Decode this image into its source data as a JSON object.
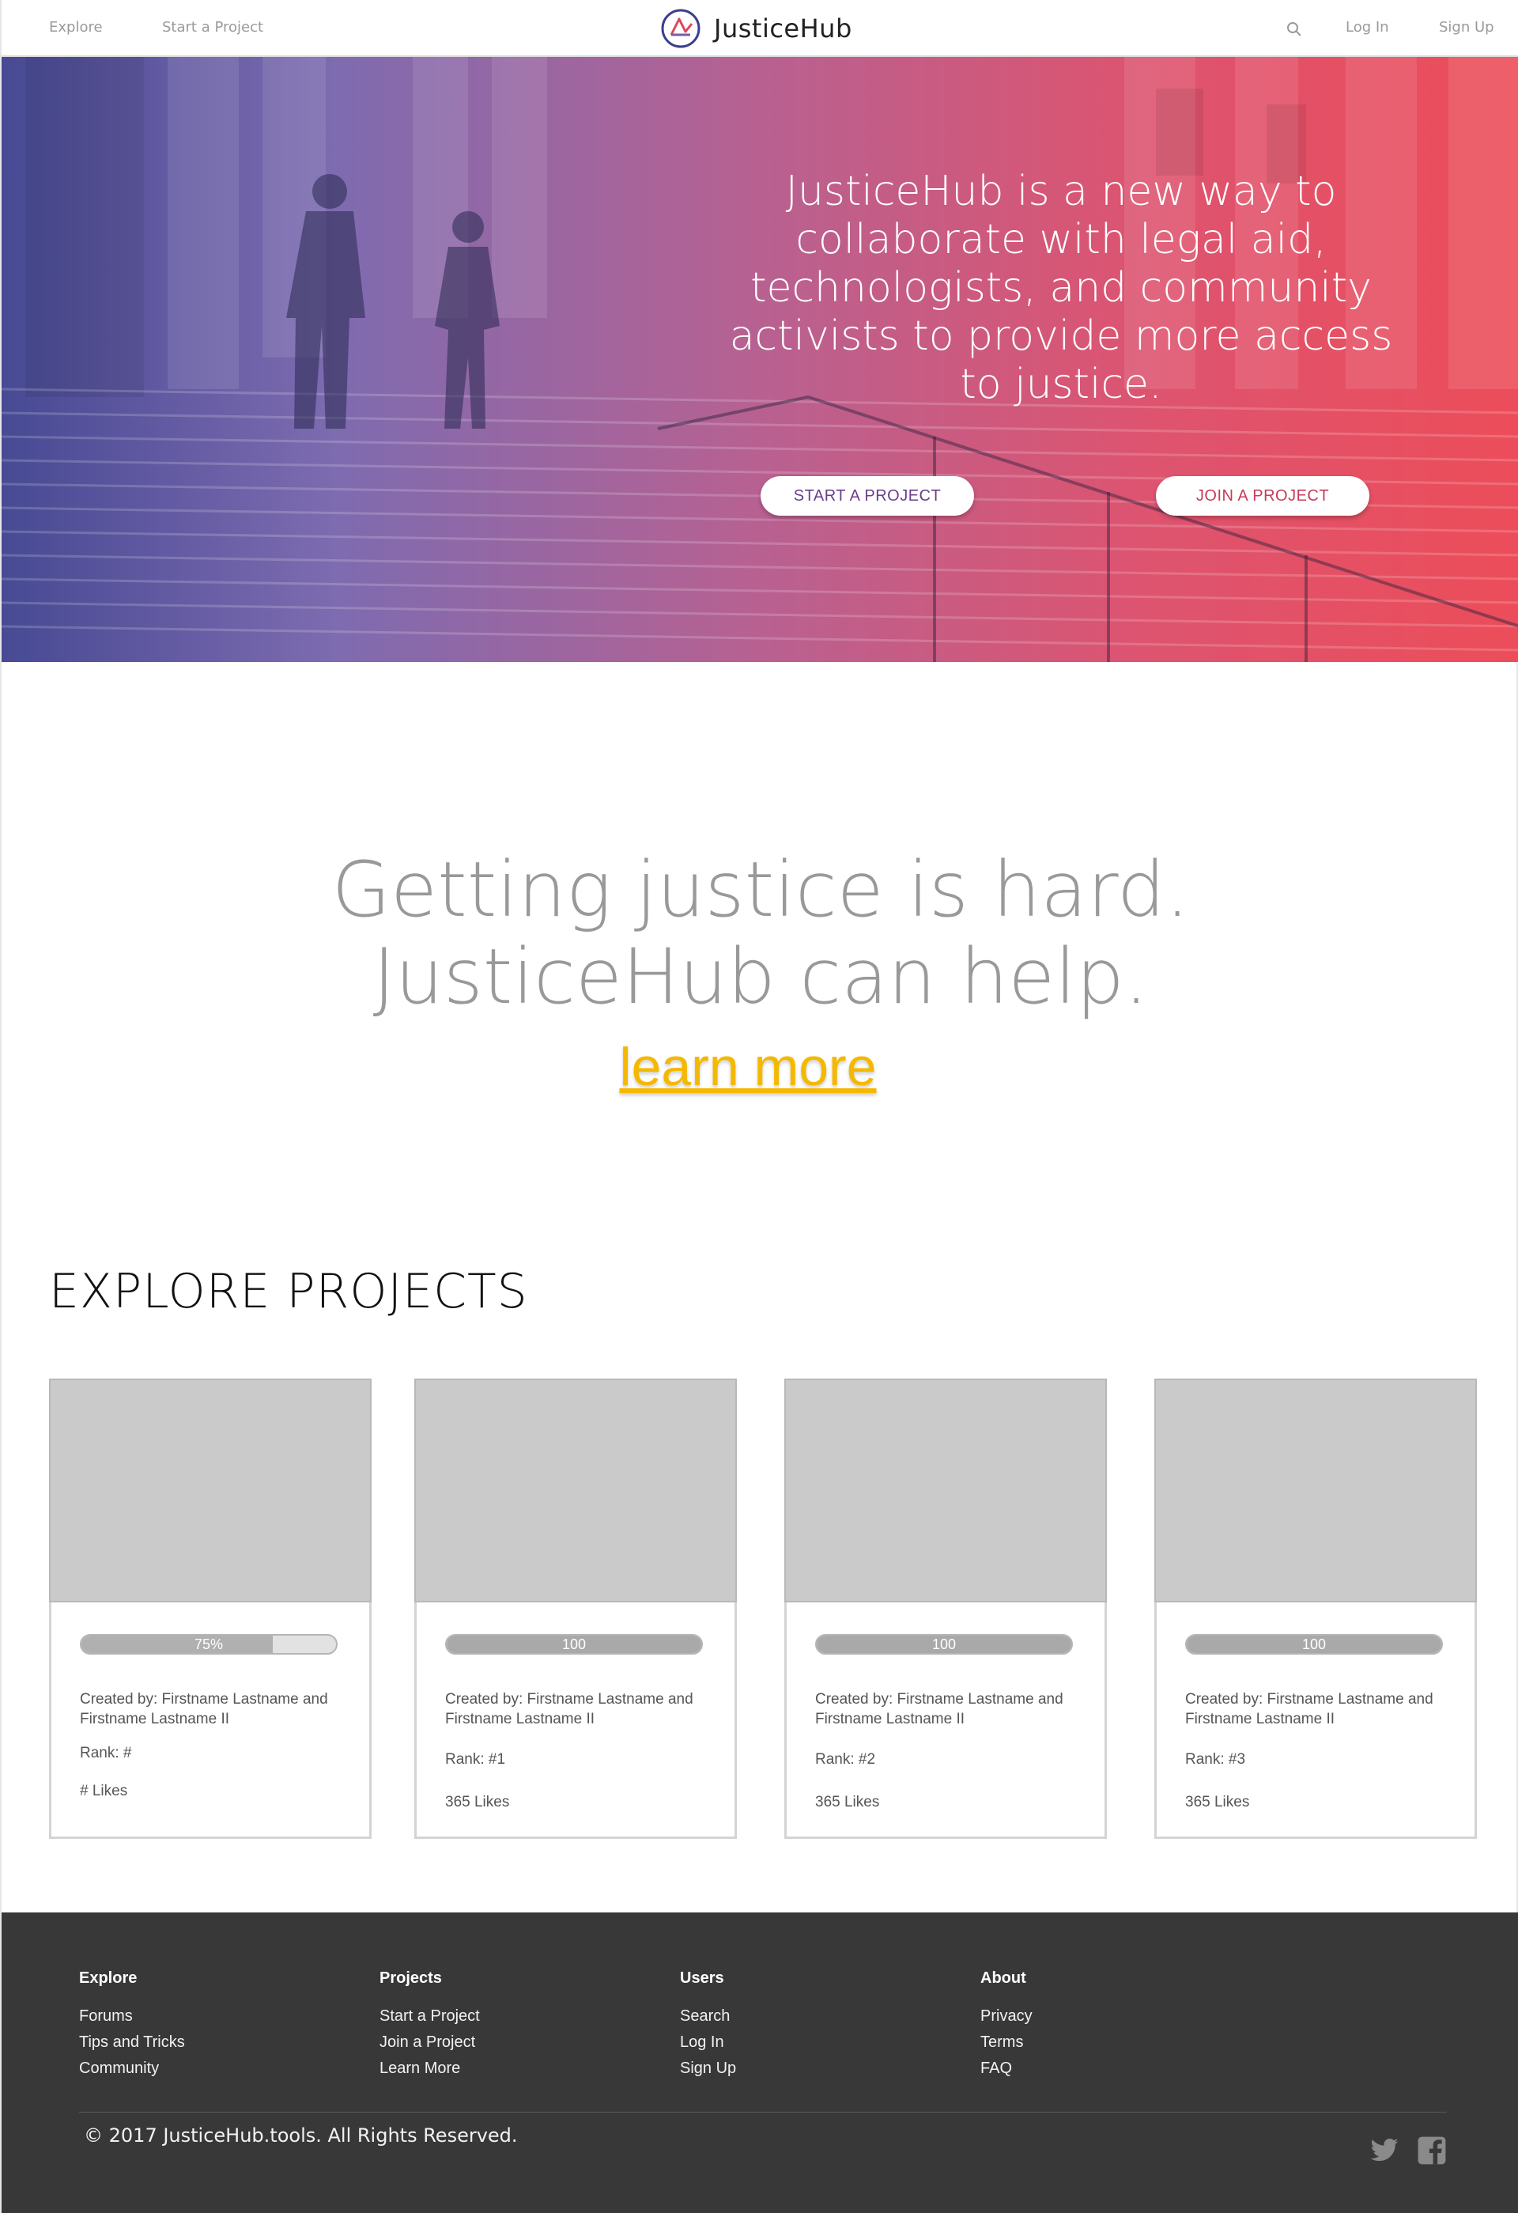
{
  "nav": {
    "explore": "Explore",
    "start_project": "Start a Project",
    "brand": "JusticeHub",
    "search_icon": "search-icon",
    "login": "Log In",
    "signup": "Sign Up"
  },
  "hero": {
    "headline": "JusticeHub is a new way to collaborate with legal aid, technologists, and community activists to provide more access to justice.",
    "start_button": "START A PROJECT",
    "join_button": "JOIN A PROJECT",
    "gradient": [
      "#474a94",
      "#b86191",
      "#ec4d59"
    ]
  },
  "tagline": {
    "line1": "Getting justice is hard.",
    "line2": "JusticeHub can help.",
    "learn_more": "learn more",
    "learn_more_color": "#f5b800"
  },
  "explore": {
    "title": "EXPLORE PROJECTS",
    "cards": [
      {
        "progress": 0.75,
        "progress_label": "75%",
        "creator": "Created by: Firstname Lastname and Firstname Lastname II",
        "rank": "Rank: #",
        "likes": "# Likes"
      },
      {
        "progress": 1.0,
        "progress_label": "100",
        "creator": "Created by: Firstname Lastname and Firstname Lastname II",
        "rank": "Rank: #1",
        "likes": "365 Likes"
      },
      {
        "progress": 1.0,
        "progress_label": "100",
        "creator": "Created by: Firstname Lastname and Firstname Lastname II",
        "rank": "Rank: #2",
        "likes": "365 Likes"
      },
      {
        "progress": 1.0,
        "progress_label": "100",
        "creator": "Created by: Firstname Lastname and Firstname Lastname II",
        "rank": "Rank: #3",
        "likes": "365 Likes"
      }
    ]
  },
  "footer": {
    "columns": [
      {
        "heading": "Explore",
        "links": [
          "Forums",
          "Tips and Tricks",
          "Community"
        ]
      },
      {
        "heading": "Projects",
        "links": [
          "Start a Project",
          "Join a Project",
          "Learn More"
        ]
      },
      {
        "heading": "Users",
        "links": [
          "Search",
          "Log In",
          "Sign Up"
        ]
      },
      {
        "heading": "About",
        "links": [
          "Privacy",
          "Terms",
          "FAQ"
        ]
      }
    ],
    "copyright": "© 2017 JusticeHub.tools. All Rights Reserved.",
    "social_icons": [
      "twitter-icon",
      "facebook-icon"
    ]
  }
}
